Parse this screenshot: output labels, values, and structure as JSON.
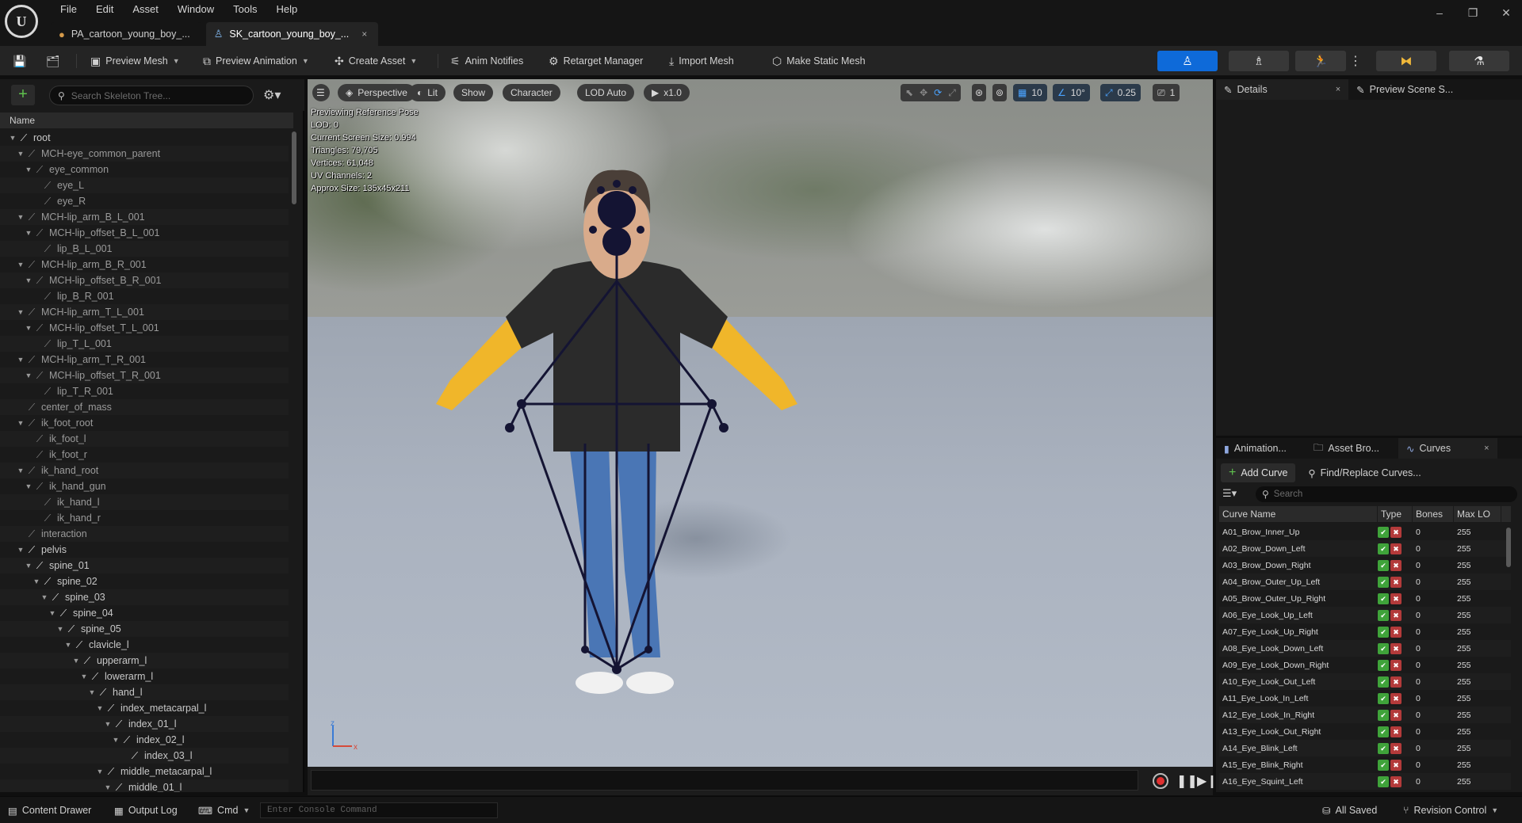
{
  "app": {
    "logo_text": "U"
  },
  "menu": [
    "File",
    "Edit",
    "Asset",
    "Window",
    "Tools",
    "Help"
  ],
  "window_controls": {
    "minimize": "–",
    "maximize": "❐",
    "close": "✕"
  },
  "tabs": [
    {
      "label": "PA_cartoon_young_boy_...",
      "icon": "animation-asset-icon"
    },
    {
      "label": "SK_cartoon_young_boy_...",
      "icon": "skeleton-icon",
      "close": "×"
    }
  ],
  "toolbar": {
    "preview_mesh": "Preview Mesh",
    "preview_animation": "Preview Animation",
    "create_asset": "Create Asset",
    "anim_notifies": "Anim Notifies",
    "retarget_manager": "Retarget Manager",
    "import_mesh": "Import Mesh",
    "make_static_mesh": "Make Static Mesh"
  },
  "skeleton_tree": {
    "search_placeholder": "Search Skeleton Tree...",
    "column_name": "Name",
    "rows": [
      {
        "label": "root",
        "depth": 0,
        "open": true,
        "dim": false
      },
      {
        "label": "MCH-eye_common_parent",
        "depth": 1,
        "open": true,
        "dim": true
      },
      {
        "label": "eye_common",
        "depth": 2,
        "open": true,
        "dim": true
      },
      {
        "label": "eye_L",
        "depth": 3,
        "open": false,
        "dim": true
      },
      {
        "label": "eye_R",
        "depth": 3,
        "open": false,
        "dim": true
      },
      {
        "label": "MCH-lip_arm_B_L_001",
        "depth": 1,
        "open": true,
        "dim": true
      },
      {
        "label": "MCH-lip_offset_B_L_001",
        "depth": 2,
        "open": true,
        "dim": true
      },
      {
        "label": "lip_B_L_001",
        "depth": 3,
        "open": false,
        "dim": true
      },
      {
        "label": "MCH-lip_arm_B_R_001",
        "depth": 1,
        "open": true,
        "dim": true
      },
      {
        "label": "MCH-lip_offset_B_R_001",
        "depth": 2,
        "open": true,
        "dim": true
      },
      {
        "label": "lip_B_R_001",
        "depth": 3,
        "open": false,
        "dim": true
      },
      {
        "label": "MCH-lip_arm_T_L_001",
        "depth": 1,
        "open": true,
        "dim": true
      },
      {
        "label": "MCH-lip_offset_T_L_001",
        "depth": 2,
        "open": true,
        "dim": true
      },
      {
        "label": "lip_T_L_001",
        "depth": 3,
        "open": false,
        "dim": true
      },
      {
        "label": "MCH-lip_arm_T_R_001",
        "depth": 1,
        "open": true,
        "dim": true
      },
      {
        "label": "MCH-lip_offset_T_R_001",
        "depth": 2,
        "open": true,
        "dim": true
      },
      {
        "label": "lip_T_R_001",
        "depth": 3,
        "open": false,
        "dim": true
      },
      {
        "label": "center_of_mass",
        "depth": 1,
        "open": false,
        "dim": true
      },
      {
        "label": "ik_foot_root",
        "depth": 1,
        "open": true,
        "dim": true
      },
      {
        "label": "ik_foot_l",
        "depth": 2,
        "open": false,
        "dim": true
      },
      {
        "label": "ik_foot_r",
        "depth": 2,
        "open": false,
        "dim": true
      },
      {
        "label": "ik_hand_root",
        "depth": 1,
        "open": true,
        "dim": true
      },
      {
        "label": "ik_hand_gun",
        "depth": 2,
        "open": true,
        "dim": true
      },
      {
        "label": "ik_hand_l",
        "depth": 3,
        "open": false,
        "dim": true
      },
      {
        "label": "ik_hand_r",
        "depth": 3,
        "open": false,
        "dim": true
      },
      {
        "label": "interaction",
        "depth": 1,
        "open": false,
        "dim": true
      },
      {
        "label": "pelvis",
        "depth": 1,
        "open": true,
        "dim": false
      },
      {
        "label": "spine_01",
        "depth": 2,
        "open": true,
        "dim": false
      },
      {
        "label": "spine_02",
        "depth": 3,
        "open": true,
        "dim": false
      },
      {
        "label": "spine_03",
        "depth": 4,
        "open": true,
        "dim": false
      },
      {
        "label": "spine_04",
        "depth": 5,
        "open": true,
        "dim": false
      },
      {
        "label": "spine_05",
        "depth": 6,
        "open": true,
        "dim": false
      },
      {
        "label": "clavicle_l",
        "depth": 7,
        "open": true,
        "dim": false
      },
      {
        "label": "upperarm_l",
        "depth": 8,
        "open": true,
        "dim": false
      },
      {
        "label": "lowerarm_l",
        "depth": 9,
        "open": true,
        "dim": false
      },
      {
        "label": "hand_l",
        "depth": 10,
        "open": true,
        "dim": false
      },
      {
        "label": "index_metacarpal_l",
        "depth": 11,
        "open": true,
        "dim": false
      },
      {
        "label": "index_01_l",
        "depth": 12,
        "open": true,
        "dim": false
      },
      {
        "label": "index_02_l",
        "depth": 13,
        "open": true,
        "dim": false
      },
      {
        "label": "index_03_l",
        "depth": 14,
        "open": false,
        "dim": false
      },
      {
        "label": "middle_metacarpal_l",
        "depth": 11,
        "open": true,
        "dim": false
      },
      {
        "label": "middle_01_l",
        "depth": 12,
        "open": true,
        "dim": false
      }
    ]
  },
  "viewport": {
    "perspective": "Perspective",
    "lit": "Lit",
    "show": "Show",
    "character": "Character",
    "lod": "LOD Auto",
    "play_rate": "x1.0",
    "grid_snap": "10",
    "rot_snap": "10°",
    "scale_snap": "0.25",
    "camera_speed": "1",
    "stats": [
      "Previewing Reference Pose",
      "LOD: 0",
      "Current Screen Size: 0.994",
      "Triangles: 79,705",
      "Vertices: 61,048",
      "UV Channels: 2",
      "Approx Size: 135x45x211"
    ],
    "axis_z": "z",
    "axis_x": "x"
  },
  "details": {
    "tab1": "Details",
    "tab1_close": "×",
    "tab2": "Preview Scene S..."
  },
  "curves_panel": {
    "tab1": "Animation...",
    "tab2": "Asset Bro...",
    "tab3": "Curves",
    "tab3_close": "×",
    "add_curve": "Add Curve",
    "find_replace": "Find/Replace Curves...",
    "search_placeholder": "Search",
    "headers": {
      "name": "Curve Name",
      "type": "Type",
      "bones": "Bones",
      "max_lod": "Max LO"
    },
    "rows": [
      {
        "name": "A01_Brow_Inner_Up",
        "bones": "0",
        "max_lod": "255"
      },
      {
        "name": "A02_Brow_Down_Left",
        "bones": "0",
        "max_lod": "255"
      },
      {
        "name": "A03_Brow_Down_Right",
        "bones": "0",
        "max_lod": "255"
      },
      {
        "name": "A04_Brow_Outer_Up_Left",
        "bones": "0",
        "max_lod": "255"
      },
      {
        "name": "A05_Brow_Outer_Up_Right",
        "bones": "0",
        "max_lod": "255"
      },
      {
        "name": "A06_Eye_Look_Up_Left",
        "bones": "0",
        "max_lod": "255"
      },
      {
        "name": "A07_Eye_Look_Up_Right",
        "bones": "0",
        "max_lod": "255"
      },
      {
        "name": "A08_Eye_Look_Down_Left",
        "bones": "0",
        "max_lod": "255"
      },
      {
        "name": "A09_Eye_Look_Down_Right",
        "bones": "0",
        "max_lod": "255"
      },
      {
        "name": "A10_Eye_Look_Out_Left",
        "bones": "0",
        "max_lod": "255"
      },
      {
        "name": "A11_Eye_Look_In_Left",
        "bones": "0",
        "max_lod": "255"
      },
      {
        "name": "A12_Eye_Look_In_Right",
        "bones": "0",
        "max_lod": "255"
      },
      {
        "name": "A13_Eye_Look_Out_Right",
        "bones": "0",
        "max_lod": "255"
      },
      {
        "name": "A14_Eye_Blink_Left",
        "bones": "0",
        "max_lod": "255"
      },
      {
        "name": "A15_Eye_Blink_Right",
        "bones": "0",
        "max_lod": "255"
      },
      {
        "name": "A16_Eye_Squint_Left",
        "bones": "0",
        "max_lod": "255"
      }
    ]
  },
  "statusbar": {
    "content_drawer": "Content Drawer",
    "output_log": "Output Log",
    "cmd": "Cmd",
    "console_placeholder": "Enter Console Command",
    "all_saved": "All Saved",
    "revision_control": "Revision Control"
  },
  "colors": {
    "accent": "#0e6ad9",
    "add_green": "#5fc24d"
  }
}
